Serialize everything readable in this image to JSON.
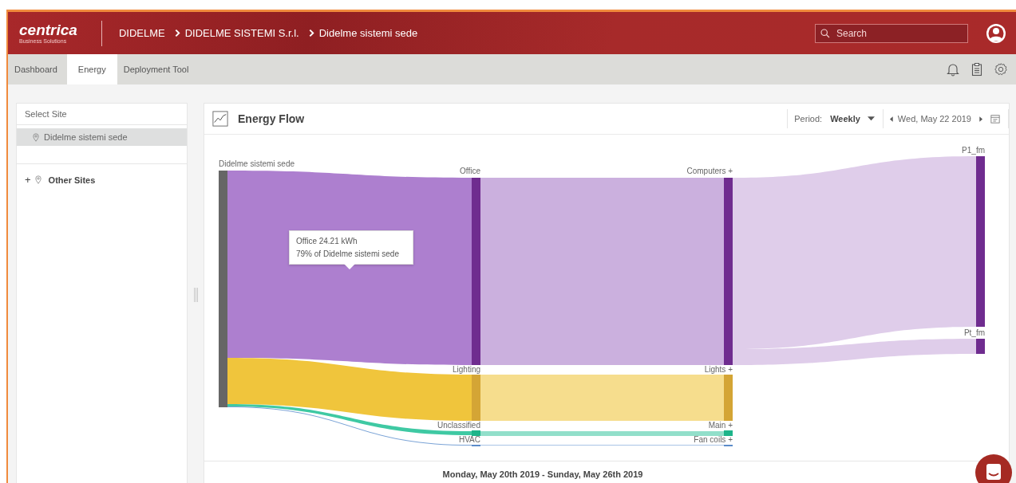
{
  "header": {
    "logo": "centrica",
    "logo_subtitle": "Business Solutions",
    "breadcrumb": [
      "DIDELME",
      "DIDELME SISTEMI S.r.l.",
      "Didelme sistemi sede"
    ],
    "search": {
      "placeholder": "Search"
    }
  },
  "tabs": [
    {
      "label": "Dashboard",
      "selected": false
    },
    {
      "label": "Energy",
      "selected": true
    },
    {
      "label": "Deployment Tool",
      "selected": false
    }
  ],
  "sidebar": {
    "title": "Select Site",
    "sites": [
      {
        "label": "Didelme sistemi sede",
        "selected": true
      }
    ],
    "other_sites": {
      "toggle": "+",
      "label": "Other Sites"
    }
  },
  "panel": {
    "title": "Energy Flow",
    "period_label": "Period:",
    "period": "Weekly",
    "date": "Wed, May 22 2019",
    "footer": "Monday, May 20th 2019 - Sunday, May 26th 2019"
  },
  "sankey": {
    "nodes": [
      {
        "label": "Didelme sistemi sede",
        "color": "#666666"
      },
      {
        "label": "Office",
        "color": "#6f2c8f"
      },
      {
        "label": "Lighting",
        "color": "#d4a535"
      },
      {
        "label": "Unclassified",
        "color": "#1db48a"
      },
      {
        "label": "HVAC",
        "color": "#5b8bc9"
      },
      {
        "label": "Computers +",
        "color": "#6f2c8f"
      },
      {
        "label": "Lights +",
        "color": "#d4a535"
      },
      {
        "label": "Main +",
        "color": "#1db48a"
      },
      {
        "label": "Fan coils +",
        "color": "#5b8bc9"
      },
      {
        "label": "P1_fm",
        "color": "#6f2c8f"
      },
      {
        "label": "Pt_fm",
        "color": "#6f2c8f"
      }
    ],
    "tooltip": [
      "Office 24.21 kWh",
      "79% of Didelme sistemi sede"
    ]
  }
}
